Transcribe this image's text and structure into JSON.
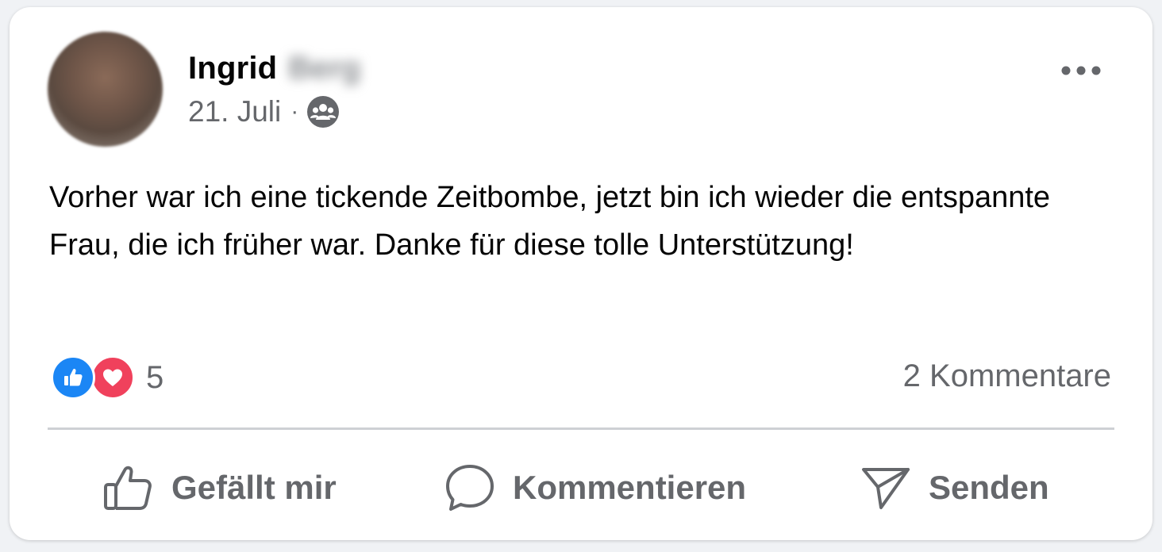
{
  "post": {
    "author_first": "Ingrid",
    "author_last": "Berg",
    "date": "21. Juli",
    "separator": "·",
    "audience_icon": "group-icon",
    "text": "Vorher war ich eine tickende Zeitbombe, jetzt bin ich wieder die entspannte Frau, die ich früher war. Danke für diese tolle Unterstützung!"
  },
  "reactions": {
    "types": [
      "like-icon",
      "love-icon"
    ],
    "count": "5",
    "comments_label": "2 Kommentare"
  },
  "actions": {
    "like_label": "Gefällt mir",
    "comment_label": "Kommentieren",
    "send_label": "Senden"
  },
  "colors": {
    "like_blue": "#1b86f5",
    "love_red": "#f0415c",
    "secondary_text": "#65676b"
  }
}
